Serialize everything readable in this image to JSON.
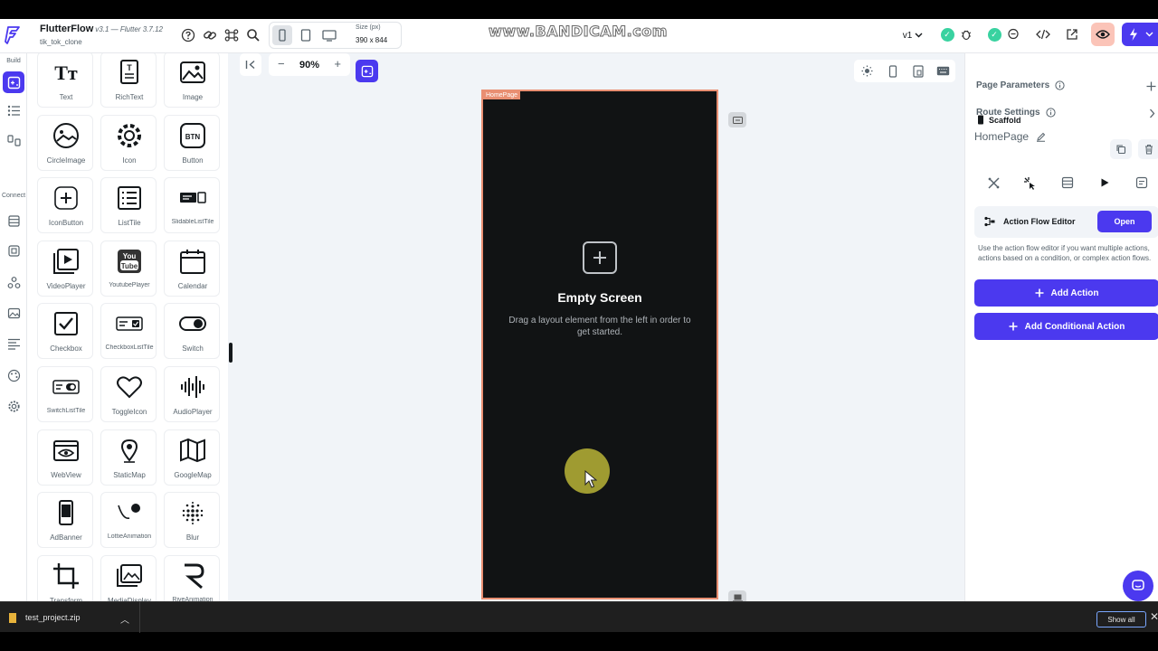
{
  "app": {
    "name": "FlutterFlow",
    "version": "v3.1 — Flutter 3.7.12",
    "project": "tik_tok_clone"
  },
  "topbar": {
    "size_label": "Size (px)",
    "size_value": "390 x 844",
    "watermark": "www.BANDICAM.com",
    "branch": "v1"
  },
  "rail": {
    "build_label": "Build",
    "connect_label": "Connect"
  },
  "widgets": [
    {
      "label": "Text",
      "icon": "text-icon"
    },
    {
      "label": "RichText",
      "icon": "richtext-icon"
    },
    {
      "label": "Image",
      "icon": "image-icon"
    },
    {
      "label": "CircleImage",
      "icon": "circle-image-icon"
    },
    {
      "label": "Icon",
      "icon": "gear-icon"
    },
    {
      "label": "Button",
      "icon": "button-icon"
    },
    {
      "label": "IconButton",
      "icon": "plus-box-icon"
    },
    {
      "label": "ListTile",
      "icon": "list-icon"
    },
    {
      "label": "SlidableListTile",
      "icon": "slidable-icon"
    },
    {
      "label": "VideoPlayer",
      "icon": "video-icon"
    },
    {
      "label": "YoutubePlayer",
      "icon": "youtube-icon"
    },
    {
      "label": "Calendar",
      "icon": "calendar-icon"
    },
    {
      "label": "Checkbox",
      "icon": "checkbox-icon"
    },
    {
      "label": "CheckboxListTile",
      "icon": "checkbox-tile-icon"
    },
    {
      "label": "Switch",
      "icon": "switch-icon"
    },
    {
      "label": "SwitchListTile",
      "icon": "switch-tile-icon"
    },
    {
      "label": "ToggleIcon",
      "icon": "heart-icon"
    },
    {
      "label": "AudioPlayer",
      "icon": "audio-icon"
    },
    {
      "label": "WebView",
      "icon": "webview-icon"
    },
    {
      "label": "StaticMap",
      "icon": "pin-icon"
    },
    {
      "label": "GoogleMap",
      "icon": "map-icon"
    },
    {
      "label": "AdBanner",
      "icon": "phone-icon"
    },
    {
      "label": "LottieAnimation",
      "icon": "lottie-icon"
    },
    {
      "label": "Blur",
      "icon": "blur-icon"
    },
    {
      "label": "Transform",
      "icon": "crop-icon"
    },
    {
      "label": "MediaDisplay",
      "icon": "media-icon"
    },
    {
      "label": "RiveAnimation",
      "icon": "rive-icon"
    }
  ],
  "canvas": {
    "zoom": "90%",
    "page_tag": "HomePage",
    "empty_title": "Empty Screen",
    "empty_subtitle": "Drag a layout element from the left in order to get started."
  },
  "properties": {
    "page_parameters": "Page Parameters",
    "route_settings": "Route Settings",
    "scaffold": "Scaffold",
    "page_name": "HomePage",
    "action_flow_editor": "Action Flow Editor",
    "open": "Open",
    "description": "Use the action flow editor if you want multiple actions, actions based on a condition, or complex action flows.",
    "add_action": "Add Action",
    "add_conditional_action": "Add Conditional Action"
  },
  "downloads": {
    "file_name": "test_project.zip",
    "show_all": "Show all"
  },
  "colors": {
    "primary": "#4b39ef",
    "canvas_bg": "#f1f4f8",
    "page_border": "#e98f72",
    "phone_bg": "#111314"
  }
}
